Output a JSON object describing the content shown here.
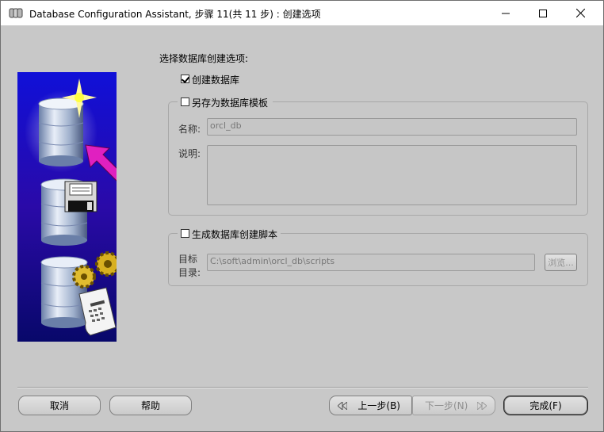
{
  "window": {
    "title": "Database Configuration Assistant, 步骤 11(共 11 步) : 创建选项",
    "icon": "database-app-icon"
  },
  "content": {
    "prompt": "选择数据库创建选项:",
    "create_db": {
      "label": "创建数据库",
      "checked": true
    },
    "save_template": {
      "label": "另存为数据库模板",
      "checked": false,
      "name_label": "名称:",
      "name_value": "orcl_db",
      "desc_label": "说明:",
      "desc_value": ""
    },
    "gen_scripts": {
      "label": "生成数据库创建脚本",
      "checked": false,
      "dest_label_line1": "目标",
      "dest_label_line2": "目录:",
      "dest_value": "C:\\soft\\admin\\orcl_db\\scripts",
      "browse_label": "浏览..."
    }
  },
  "footer": {
    "cancel": "取消",
    "help": "帮助",
    "back": "上一步(B)",
    "next": "下一步(N)",
    "finish": "完成(F)"
  },
  "colors": {
    "window_bg": "#c8c8c8",
    "panel_gradient_top": "#1414d0",
    "panel_gradient_bottom": "#0a0a70",
    "arrow_magenta": "#e020c0"
  }
}
